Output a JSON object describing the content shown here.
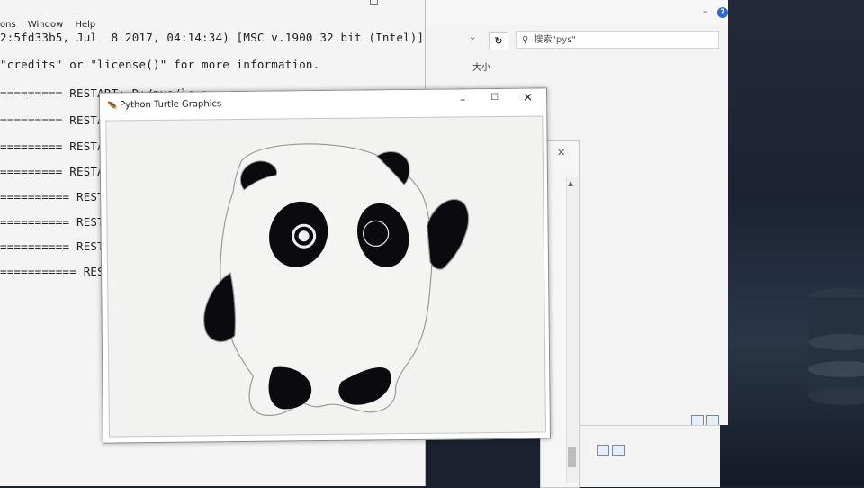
{
  "shell": {
    "menus": [
      "ons",
      "Window",
      "Help"
    ],
    "lines": [
      "2:5fd33b5, Jul  8 2017, 04:14:34) [MSC v.1900 32 bit (Intel)]",
      "\"credits\" or \"license()\" for more information.",
      "========= RESTART: D:/pys/ls.py ==========================",
      "========= RESTA",
      "========= RESTA",
      "========= RESTA",
      "========== RESTA",
      "========== RESTA",
      "========== RESTA",
      "=========== RESTA"
    ]
  },
  "explorer": {
    "search_placeholder": "搜索\"pys\"",
    "column_size": "大小",
    "help": "?"
  },
  "turtle": {
    "title": "Python Turtle Graphics",
    "min": "–",
    "max": "☐",
    "close": "✕"
  },
  "colors": {
    "panda_black": "#0b0b0f",
    "panda_outline": "#9a9a9a",
    "canvas_bg": "#f2f2f0",
    "desktop": "#1b2334"
  },
  "icons": [
    "feather-icon",
    "refresh-icon",
    "search-icon",
    "help-icon",
    "chevron-down-icon",
    "details-view-icon",
    "large-icons-view-icon"
  ]
}
